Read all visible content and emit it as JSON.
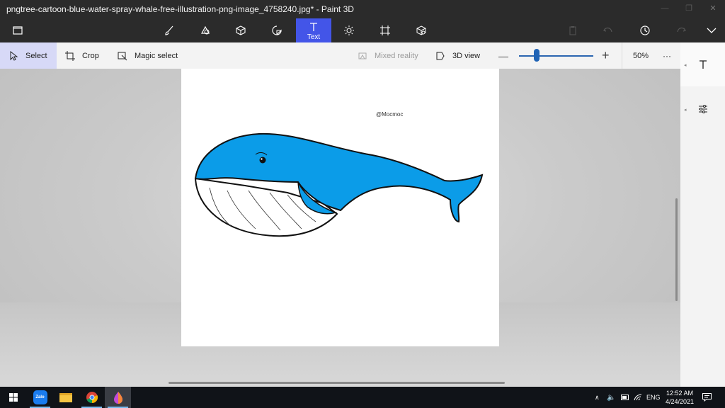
{
  "window": {
    "title": "pngtree-cartoon-blue-water-spray-whale-free-illustration-png-image_4758240.jpg* - Paint 3D",
    "minimize_icon": "minimize-icon",
    "maximize_icon": "maximize-icon",
    "close_icon": "close-icon"
  },
  "toolbar": {
    "tools": [
      {
        "icon": "menu-icon"
      },
      {
        "icon": "brushes-icon"
      },
      {
        "icon": "2d-shapes-icon"
      },
      {
        "icon": "3d-shapes-icon"
      },
      {
        "icon": "stickers-icon"
      },
      {
        "icon": "text-icon",
        "label": "Text"
      },
      {
        "icon": "effects-icon"
      },
      {
        "icon": "canvas-icon"
      },
      {
        "icon": "3d-library-icon"
      }
    ],
    "right": [
      "paste-icon",
      "undo-icon",
      "history-icon",
      "redo-icon",
      "expand-icon"
    ]
  },
  "subbar": {
    "select": "Select",
    "crop": "Crop",
    "magic_select": "Magic select",
    "mixed_reality": "Mixed reality",
    "view_3d": "3D view",
    "zoom_value": "50%",
    "more": "···"
  },
  "canvas": {
    "watermark": "@Mocmoc"
  },
  "side_panel": {
    "items": [
      "text-settings-icon",
      "adjust-icon"
    ]
  },
  "taskbar": {
    "apps": [
      "windows-start-icon",
      "zalo-icon",
      "file-explorer-icon",
      "chrome-icon",
      "paint-3d-icon"
    ],
    "zalo_label": "Zalo",
    "language": "ENG",
    "time": "12:52 AM",
    "date": "4/24/2021"
  },
  "colors": {
    "accent": "#4355e8",
    "whale_blue": "#0b9ce8",
    "chrome": "#2b2b2b"
  }
}
